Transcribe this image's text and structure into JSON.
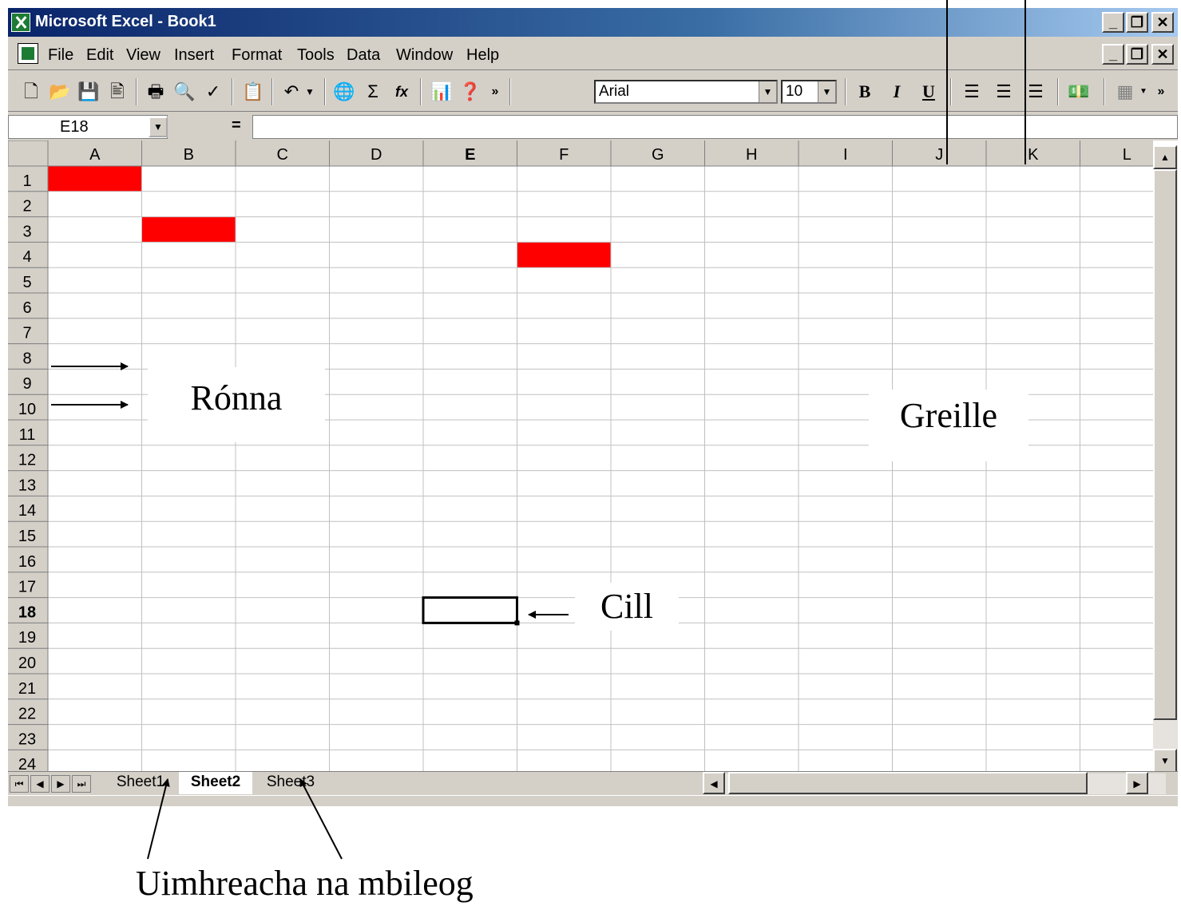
{
  "window": {
    "title": "Microsoft Excel - Book1",
    "minimize": "_",
    "restore": "❐",
    "close": "✕"
  },
  "menu": [
    "File",
    "Edit",
    "View",
    "Insert",
    "Format",
    "Tools",
    "Data",
    "Window",
    "Help"
  ],
  "toolbar": {
    "font_name": "Arial",
    "font_size": "10",
    "bold": "B",
    "italic": "I",
    "underline": "U",
    "sigma": "Σ",
    "fx": "fx",
    "more": "»"
  },
  "formula_bar": {
    "name_box": "E18",
    "equals": "="
  },
  "grid": {
    "columns": [
      "A",
      "B",
      "C",
      "D",
      "E",
      "F",
      "G",
      "H",
      "I",
      "J",
      "K",
      "L"
    ],
    "rows": [
      "1",
      "2",
      "3",
      "4",
      "5",
      "6",
      "7",
      "8",
      "9",
      "10",
      "11",
      "12",
      "13",
      "14",
      "15",
      "16",
      "17",
      "18",
      "19",
      "20",
      "21",
      "22",
      "23",
      "24"
    ],
    "active_cell": "E18",
    "highlight_color": "#ff0000",
    "filled_cells": [
      "A1",
      "B3",
      "F4"
    ]
  },
  "sheets": {
    "tabs": [
      "Sheet1",
      "Sheet2",
      "Sheet3"
    ],
    "active": "Sheet2"
  },
  "annotations": {
    "rows": "Rónna",
    "grid": "Greille",
    "cell": "Cill",
    "sheet_numbers": "Uimhreacha na mbileog"
  }
}
